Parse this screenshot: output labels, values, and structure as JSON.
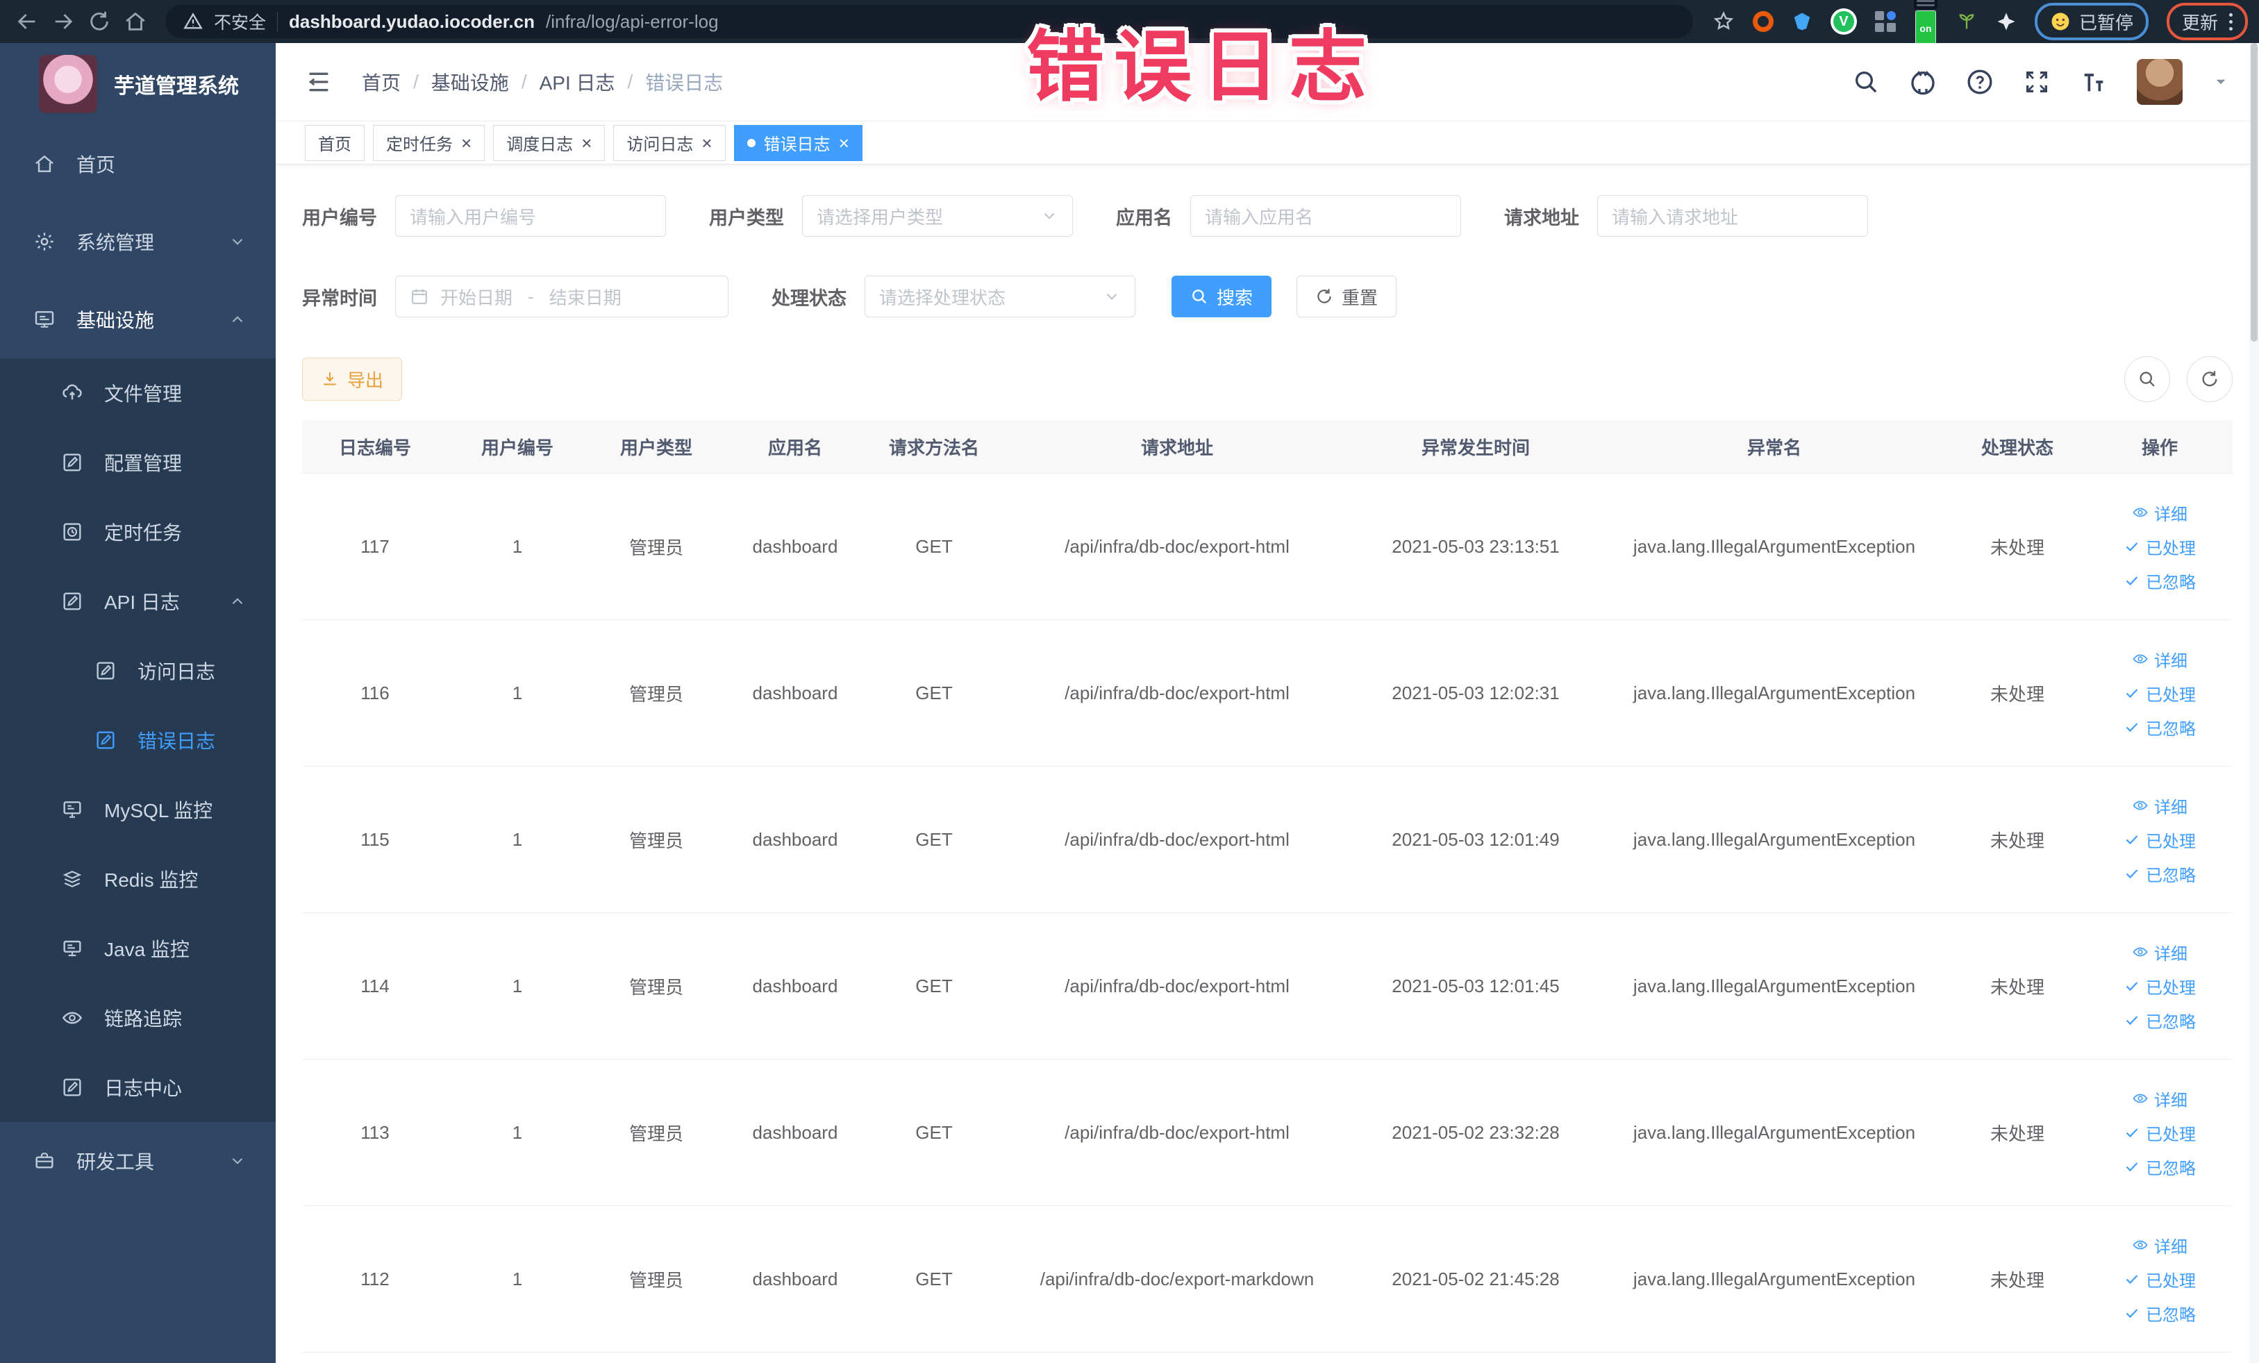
{
  "browser": {
    "security_label": "不安全",
    "url_host": "dashboard.yudao.iocoder.cn",
    "url_path": "/infra/log/api-error-log",
    "on_label": "on",
    "v_label": "V",
    "paused_label": "已暂停",
    "update_label": "更新"
  },
  "overlay": {
    "text": "错误日志"
  },
  "sidebar": {
    "title": "芋道管理系统",
    "items": [
      {
        "label": "首页",
        "icon": "home",
        "level": 1
      },
      {
        "label": "系统管理",
        "icon": "gear",
        "level": 1,
        "chevron": "down"
      },
      {
        "label": "基础设施",
        "icon": "infra",
        "level": 1,
        "chevron": "up",
        "white": true
      },
      {
        "label": "文件管理",
        "icon": "upload",
        "level": 2,
        "sub": true
      },
      {
        "label": "配置管理",
        "icon": "edit",
        "level": 2,
        "sub": true
      },
      {
        "label": "定时任务",
        "icon": "task",
        "level": 2,
        "sub": true
      },
      {
        "label": "API 日志",
        "icon": "edit",
        "level": 2,
        "sub": true,
        "chevron": "up"
      },
      {
        "label": "访问日志",
        "icon": "edit",
        "level": 3,
        "sub": true
      },
      {
        "label": "错误日志",
        "icon": "edit",
        "level": 3,
        "sub": true,
        "active": true
      },
      {
        "label": "MySQL 监控",
        "icon": "mysql",
        "level": 2,
        "sub": true
      },
      {
        "label": "Redis 监控",
        "icon": "redis",
        "level": 2,
        "sub": true
      },
      {
        "label": "Java 监控",
        "icon": "java",
        "level": 2,
        "sub": true
      },
      {
        "label": "链路追踪",
        "icon": "eye",
        "level": 2,
        "sub": true
      },
      {
        "label": "日志中心",
        "icon": "edit",
        "level": 2,
        "sub": true
      },
      {
        "label": "研发工具",
        "icon": "tool",
        "level": 1,
        "chevron": "down"
      }
    ]
  },
  "header": {
    "breadcrumb": [
      "首页",
      "基础设施",
      "API 日志",
      "错误日志"
    ]
  },
  "tabs": [
    {
      "label": "首页",
      "closable": false,
      "active": false
    },
    {
      "label": "定时任务",
      "closable": true,
      "active": false
    },
    {
      "label": "调度日志",
      "closable": true,
      "active": false
    },
    {
      "label": "访问日志",
      "closable": true,
      "active": false
    },
    {
      "label": "错误日志",
      "closable": true,
      "active": true
    }
  ],
  "filters": {
    "user_id": {
      "label": "用户编号",
      "placeholder": "请输入用户编号"
    },
    "user_type": {
      "label": "用户类型",
      "placeholder": "请选择用户类型"
    },
    "app_name": {
      "label": "应用名",
      "placeholder": "请输入应用名"
    },
    "req_url": {
      "label": "请求地址",
      "placeholder": "请输入请求地址"
    },
    "exc_time": {
      "label": "异常时间",
      "start_placeholder": "开始日期",
      "separator": "-",
      "end_placeholder": "结束日期"
    },
    "status": {
      "label": "处理状态",
      "placeholder": "请选择处理状态"
    },
    "search_label": "搜索",
    "reset_label": "重置"
  },
  "toolbar": {
    "export_label": "导出"
  },
  "table": {
    "headers": [
      "日志编号",
      "用户编号",
      "用户类型",
      "应用名",
      "请求方法名",
      "请求地址",
      "异常发生时间",
      "异常名",
      "处理状态",
      "操作"
    ],
    "rows": [
      [
        "117",
        "1",
        "管理员",
        "dashboard",
        "GET",
        "/api/infra/db-doc/export-html",
        "2021-05-03 23:13:51",
        "java.lang.IllegalArgumentException",
        "未处理"
      ],
      [
        "116",
        "1",
        "管理员",
        "dashboard",
        "GET",
        "/api/infra/db-doc/export-html",
        "2021-05-03 12:02:31",
        "java.lang.IllegalArgumentException",
        "未处理"
      ],
      [
        "115",
        "1",
        "管理员",
        "dashboard",
        "GET",
        "/api/infra/db-doc/export-html",
        "2021-05-03 12:01:49",
        "java.lang.IllegalArgumentException",
        "未处理"
      ],
      [
        "114",
        "1",
        "管理员",
        "dashboard",
        "GET",
        "/api/infra/db-doc/export-html",
        "2021-05-03 12:01:45",
        "java.lang.IllegalArgumentException",
        "未处理"
      ],
      [
        "113",
        "1",
        "管理员",
        "dashboard",
        "GET",
        "/api/infra/db-doc/export-html",
        "2021-05-02 23:32:28",
        "java.lang.IllegalArgumentException",
        "未处理"
      ],
      [
        "112",
        "1",
        "管理员",
        "dashboard",
        "GET",
        "/api/infra/db-doc/export-markdown",
        "2021-05-02 21:45:28",
        "java.lang.IllegalArgumentException",
        "未处理"
      ]
    ],
    "row_actions": [
      "详细",
      "已处理",
      "已忽略"
    ]
  },
  "colors": {
    "accent": "#409eff",
    "active_tab": "#409eff",
    "export": "#e6a23c",
    "overlay": "#ee3b5f"
  }
}
